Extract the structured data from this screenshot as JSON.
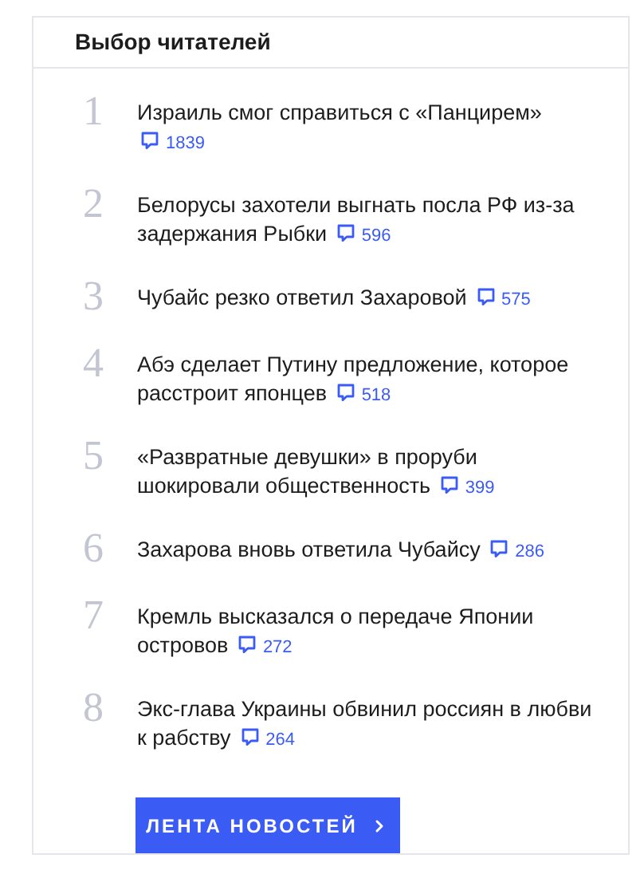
{
  "title": "Выбор читателей",
  "items": [
    {
      "rank": "1",
      "headline": "Израиль смог справиться с «Панцирем»",
      "comments": "1839"
    },
    {
      "rank": "2",
      "headline": "Белорусы захотели выгнать посла РФ из-за задержания Рыбки",
      "comments": "596"
    },
    {
      "rank": "3",
      "headline": "Чубайс резко ответил Захаровой",
      "comments": "575"
    },
    {
      "rank": "4",
      "headline": "Абэ сделает Путину предложение, которое расстроит японцев",
      "comments": "518"
    },
    {
      "rank": "5",
      "headline": "«Развратные девушки» в проруби шокировали общественность",
      "comments": "399"
    },
    {
      "rank": "6",
      "headline": "Захарова вновь ответила Чубайсу",
      "comments": "286"
    },
    {
      "rank": "7",
      "headline": "Кремль высказался о передаче Японии островов",
      "comments": "272"
    },
    {
      "rank": "8",
      "headline": "Экс-глава Украины обвинил россиян в любви к рабству",
      "comments": "264"
    }
  ],
  "button": "ЛЕНТА НОВОСТЕЙ"
}
